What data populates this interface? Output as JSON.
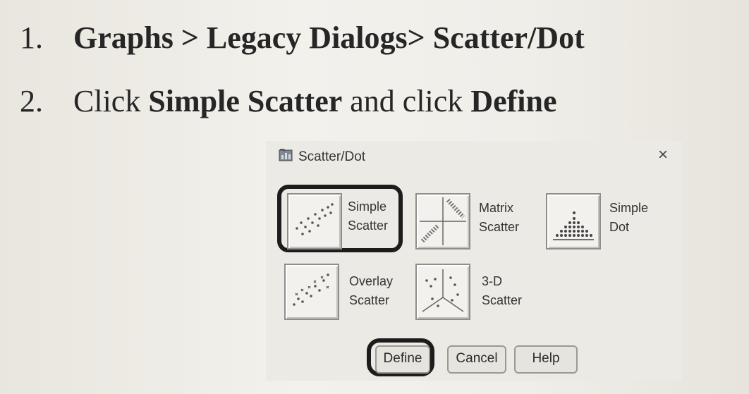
{
  "steps": [
    {
      "number": "1.",
      "text": "Graphs > Legacy Dialogs> Scatter/Dot"
    },
    {
      "number": "2.",
      "prefix": "Click ",
      "bold1": "Simple Scatter",
      "middle": " and click ",
      "bold2": "Define"
    }
  ],
  "dialog": {
    "title": "Scatter/Dot",
    "close_glyph": "×",
    "options": [
      {
        "label": "Simple\nScatter",
        "icon": "simple-scatter-icon",
        "highlighted": true
      },
      {
        "label": "Matrix\nScatter",
        "icon": "matrix-scatter-icon",
        "highlighted": false
      },
      {
        "label": "Simple\nDot",
        "icon": "simple-dot-icon",
        "highlighted": false
      },
      {
        "label": "Overlay\nScatter",
        "icon": "overlay-scatter-icon",
        "highlighted": false
      },
      {
        "label": "3-D\nScatter",
        "icon": "3d-scatter-icon",
        "highlighted": false
      }
    ],
    "buttons": {
      "define": "Define",
      "cancel": "Cancel",
      "help": "Help"
    }
  }
}
